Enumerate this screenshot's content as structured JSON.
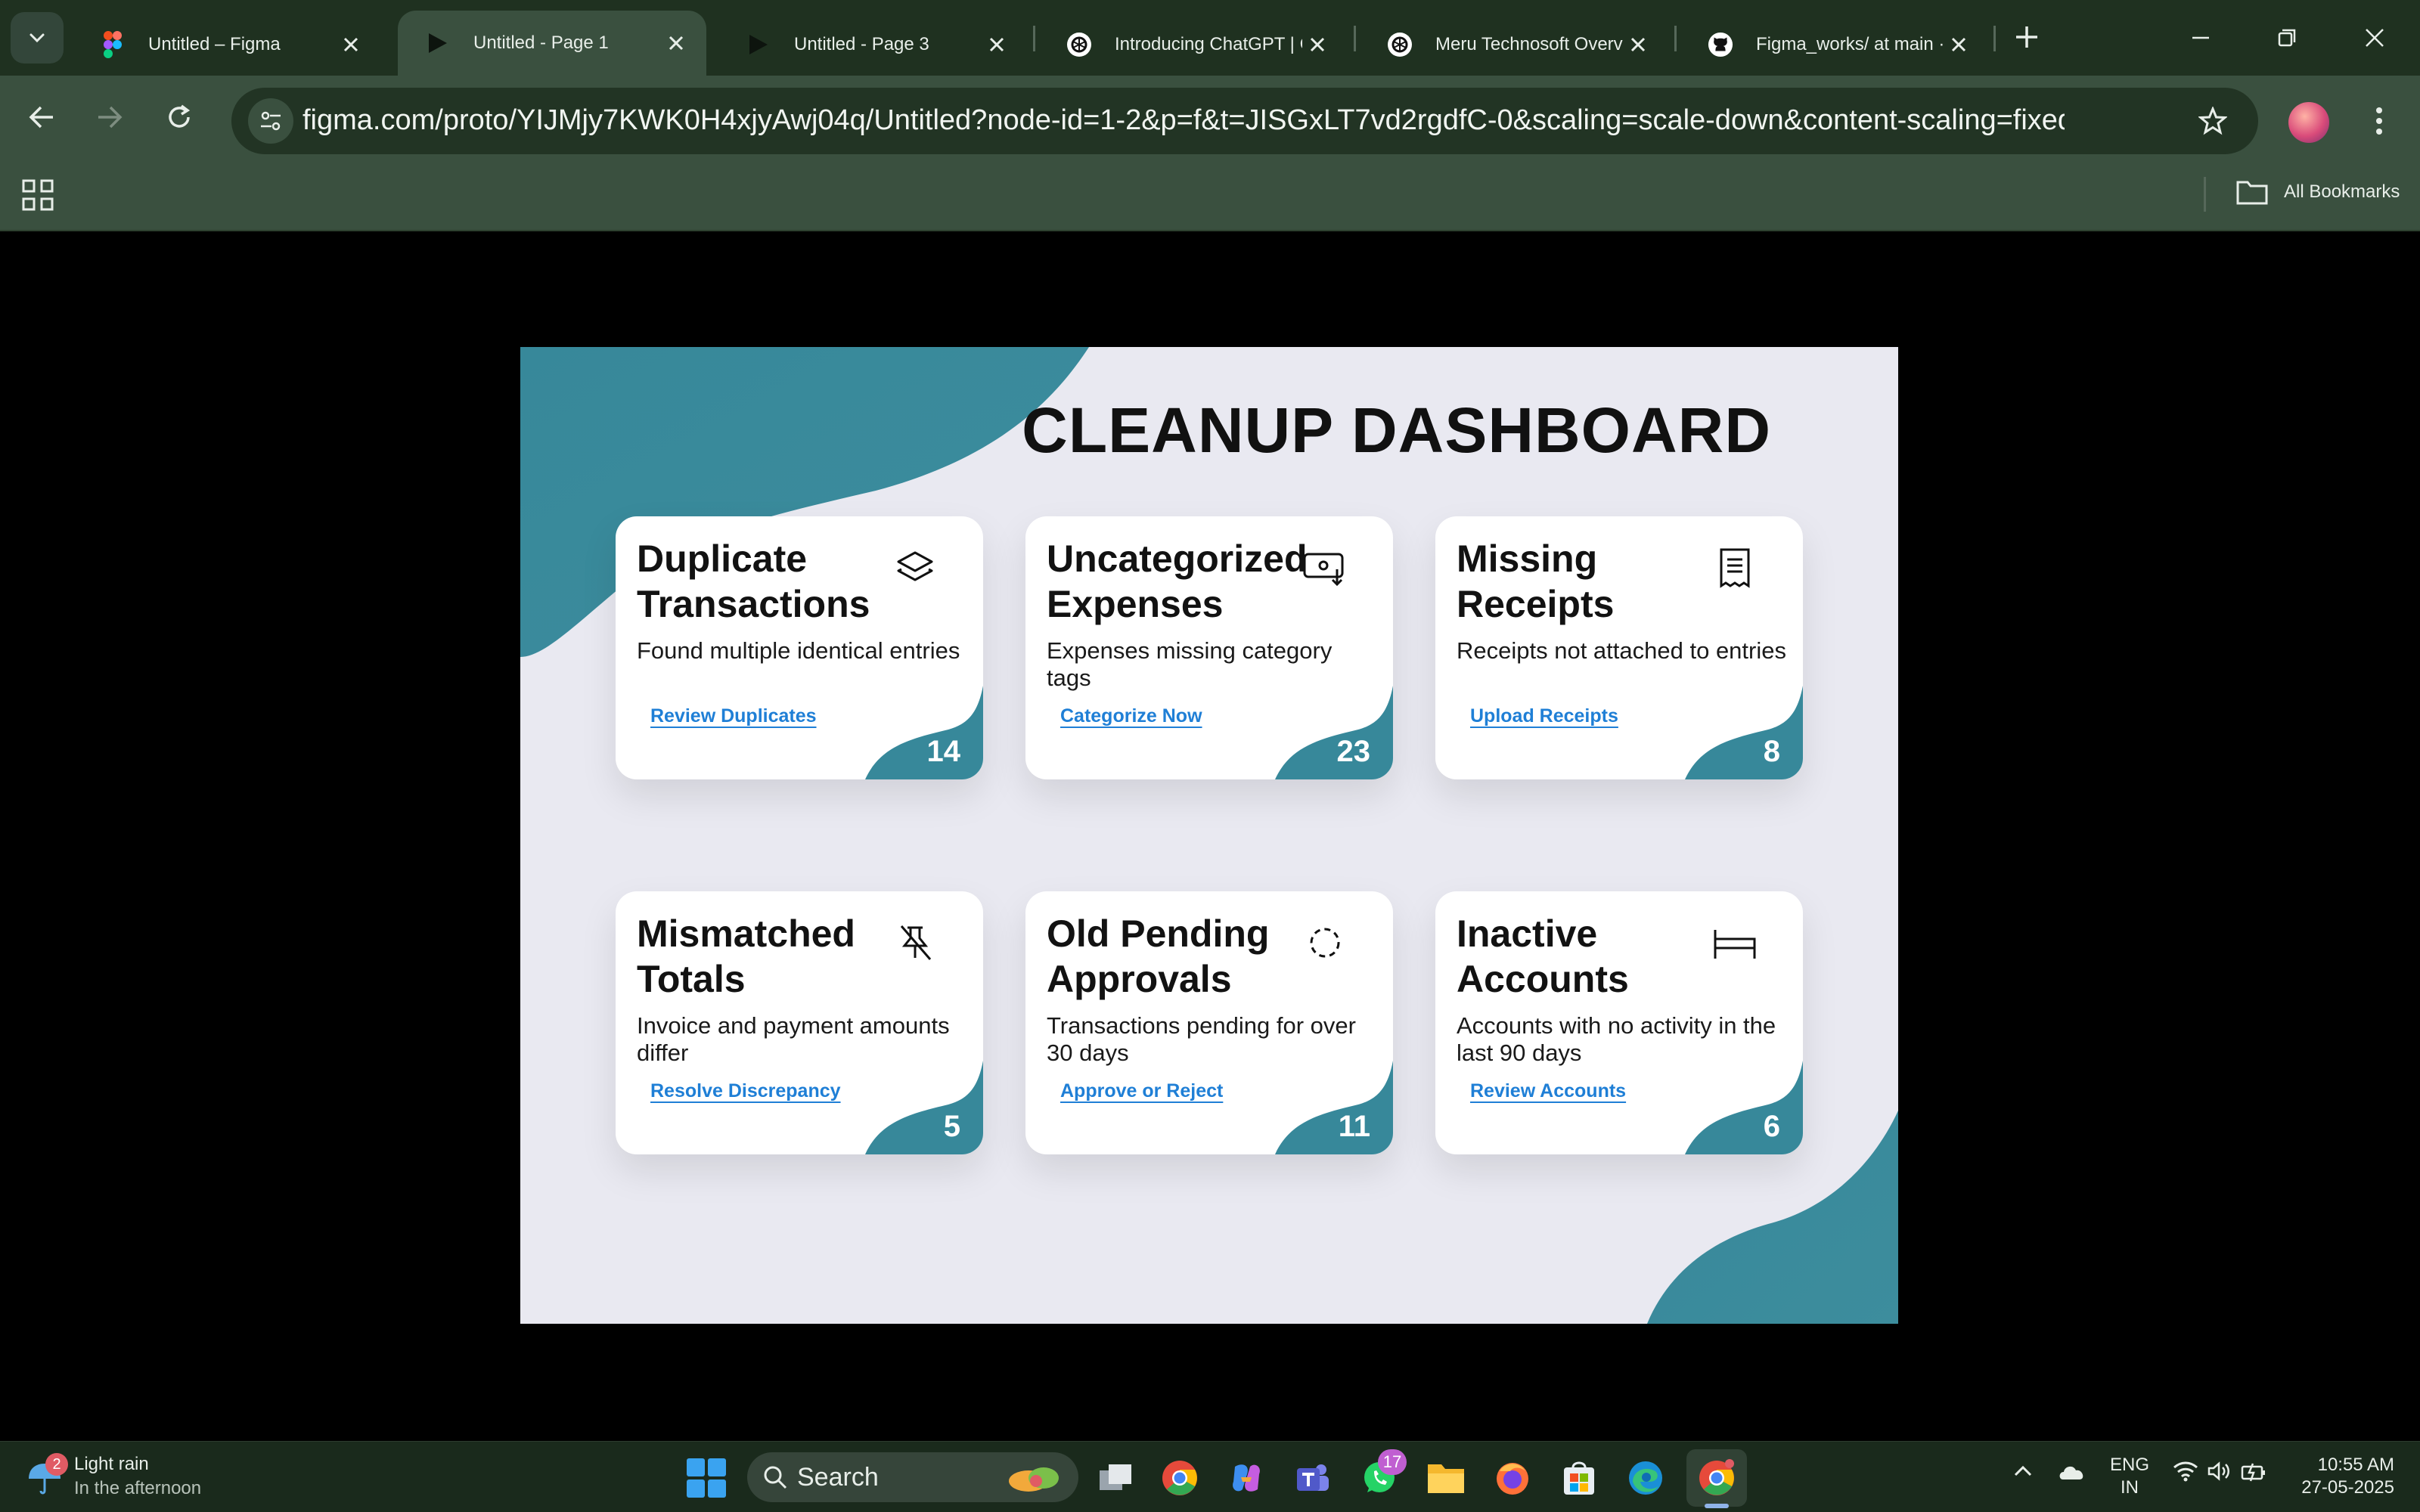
{
  "browser": {
    "tabs": [
      {
        "label": "Untitled – Figma",
        "icon": "figma-logo-icon",
        "active": false
      },
      {
        "label": "Untitled - Page 1",
        "icon": "play-icon",
        "active": true
      },
      {
        "label": "Untitled - Page 3",
        "icon": "play-icon",
        "active": false
      },
      {
        "label": "Introducing ChatGPT | C",
        "icon": "openai-logo-icon",
        "active": false
      },
      {
        "label": "Meru Technosoft Overvie",
        "icon": "openai-logo-icon",
        "active": false
      },
      {
        "label": "Figma_works/ at main ·",
        "icon": "github-logo-icon",
        "active": false
      }
    ],
    "url": "figma.com/proto/YIJMjy7KWK0H4xjyAwj04q/Untitled?node-id=1-2&p=f&t=JISGxLT7vd2rgdfC-0&scaling=scale-down&content-scaling=fixed&page-id=0%...",
    "bookmarks_label": "All Bookmarks"
  },
  "dashboard": {
    "title": "CLEANUP DASHBOARD",
    "accent_color": "#3a8a9c",
    "link_color": "#1f7fd6",
    "cards": [
      {
        "title": "Duplicate Transactions",
        "description": "Found multiple identical entries",
        "action": "Review Duplicates",
        "count": "14",
        "icon": "layers-icon"
      },
      {
        "title": "Uncategorized Expenses",
        "description": "Expenses missing category tags",
        "action": "Categorize Now",
        "count": "23",
        "icon": "money-download-icon"
      },
      {
        "title": "Missing Receipts",
        "description": "Receipts not attached to entries",
        "action": "Upload Receipts",
        "count": "8",
        "icon": "receipt-icon"
      },
      {
        "title": "Mismatched Totals",
        "description": "Invoice and payment amounts differ",
        "action": "Resolve Discrepancy",
        "count": "5",
        "icon": "pin-off-icon"
      },
      {
        "title": "Old Pending Approvals",
        "description": "Transactions pending for over 30 days",
        "action": "Approve or Reject",
        "count": "11",
        "icon": "dashed-circle-icon"
      },
      {
        "title": "Inactive Accounts",
        "description": "Accounts with no activity in the last 90 days",
        "action": "Review Accounts",
        "count": "6",
        "icon": "bed-icon"
      }
    ]
  },
  "taskbar": {
    "weather": {
      "title": "Light rain",
      "subtitle": "In the afternoon",
      "badge": "2"
    },
    "search_label": "Search",
    "whatsapp_badge": "17",
    "language": {
      "line1": "ENG",
      "line2": "IN"
    },
    "clock": {
      "time": "10:55 AM",
      "date": "27-05-2025"
    }
  }
}
